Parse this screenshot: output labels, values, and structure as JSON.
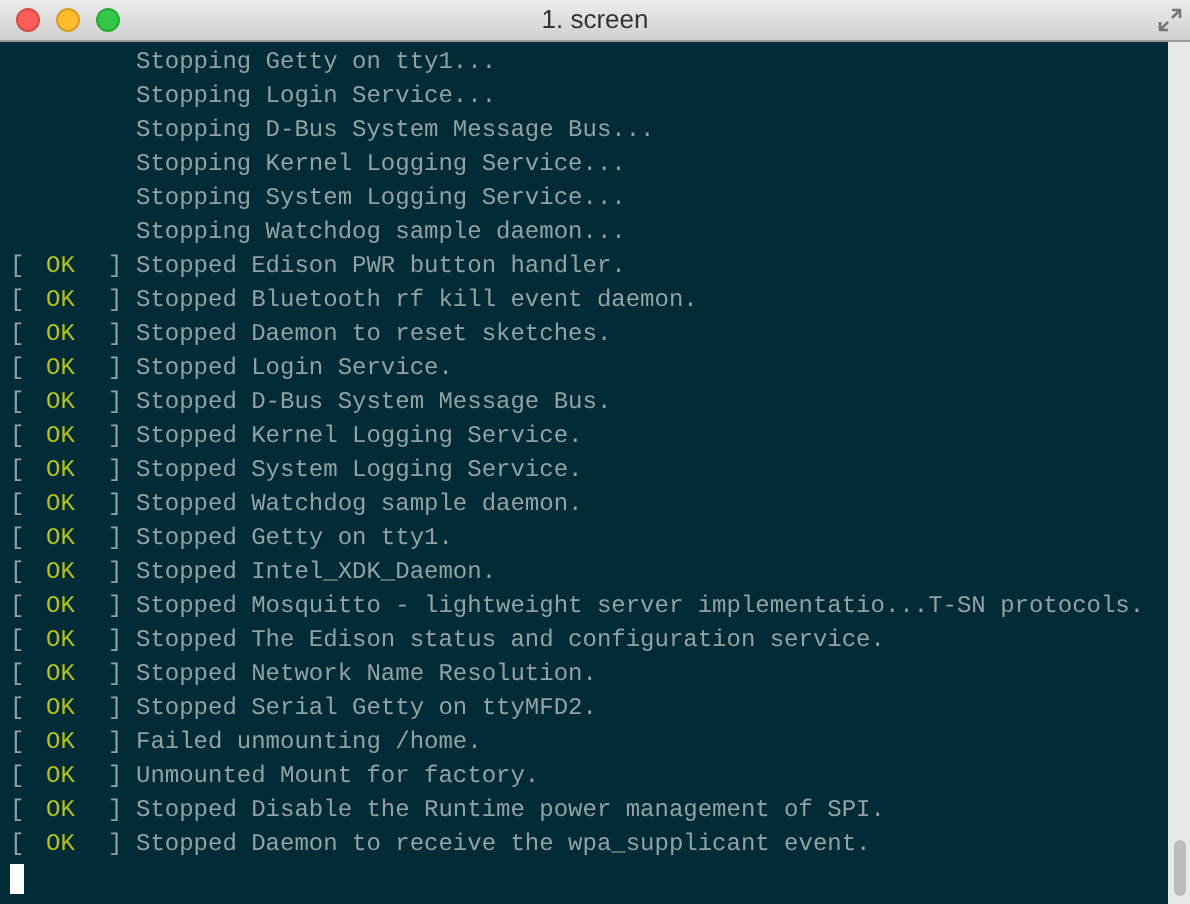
{
  "window": {
    "title": "1. screen"
  },
  "lines": [
    {
      "kind": "plain",
      "text": "Stopping Getty on tty1..."
    },
    {
      "kind": "plain",
      "text": "Stopping Login Service..."
    },
    {
      "kind": "plain",
      "text": "Stopping D-Bus System Message Bus..."
    },
    {
      "kind": "plain",
      "text": "Stopping Kernel Logging Service..."
    },
    {
      "kind": "plain",
      "text": "Stopping System Logging Service..."
    },
    {
      "kind": "plain",
      "text": "Stopping Watchdog sample daemon..."
    },
    {
      "kind": "status",
      "open": "[",
      "status": "OK",
      "close": "]",
      "text": "Stopped Edison PWR button handler."
    },
    {
      "kind": "status",
      "open": "[",
      "status": "OK",
      "close": "]",
      "text": "Stopped Bluetooth rf kill event daemon."
    },
    {
      "kind": "status",
      "open": "[",
      "status": "OK",
      "close": "]",
      "text": "Stopped Daemon to reset sketches."
    },
    {
      "kind": "status",
      "open": "[",
      "status": "OK",
      "close": "]",
      "text": "Stopped Login Service."
    },
    {
      "kind": "status",
      "open": "[",
      "status": "OK",
      "close": "]",
      "text": "Stopped D-Bus System Message Bus."
    },
    {
      "kind": "status",
      "open": "[",
      "status": "OK",
      "close": "]",
      "text": "Stopped Kernel Logging Service."
    },
    {
      "kind": "status",
      "open": "[",
      "status": "OK",
      "close": "]",
      "text": "Stopped System Logging Service."
    },
    {
      "kind": "status",
      "open": "[",
      "status": "OK",
      "close": "]",
      "text": "Stopped Watchdog sample daemon."
    },
    {
      "kind": "status",
      "open": "[",
      "status": "OK",
      "close": "]",
      "text": "Stopped Getty on tty1."
    },
    {
      "kind": "status",
      "open": "[",
      "status": "OK",
      "close": "]",
      "text": "Stopped Intel_XDK_Daemon."
    },
    {
      "kind": "status",
      "open": "[",
      "status": "OK",
      "close": "]",
      "text": "Stopped Mosquitto - lightweight server implementatio...T-SN protocols."
    },
    {
      "kind": "status",
      "open": "[",
      "status": "OK",
      "close": "]",
      "text": "Stopped The Edison status and configuration service."
    },
    {
      "kind": "status",
      "open": "[",
      "status": "OK",
      "close": "]",
      "text": "Stopped Network Name Resolution."
    },
    {
      "kind": "status",
      "open": "[",
      "status": "OK",
      "close": "]",
      "text": "Stopped Serial Getty on ttyMFD2."
    },
    {
      "kind": "status",
      "open": "[",
      "status": "OK",
      "close": "]",
      "text": "Failed unmounting /home."
    },
    {
      "kind": "status",
      "open": "[",
      "status": "OK",
      "close": "]",
      "text": "Unmounted Mount for factory."
    },
    {
      "kind": "status",
      "open": "[",
      "status": "OK",
      "close": "]",
      "text": "Stopped Disable the Runtime power management of SPI."
    },
    {
      "kind": "status",
      "open": "[",
      "status": "OK",
      "close": "]",
      "text": "Stopped Daemon to receive the wpa_supplicant event."
    }
  ]
}
